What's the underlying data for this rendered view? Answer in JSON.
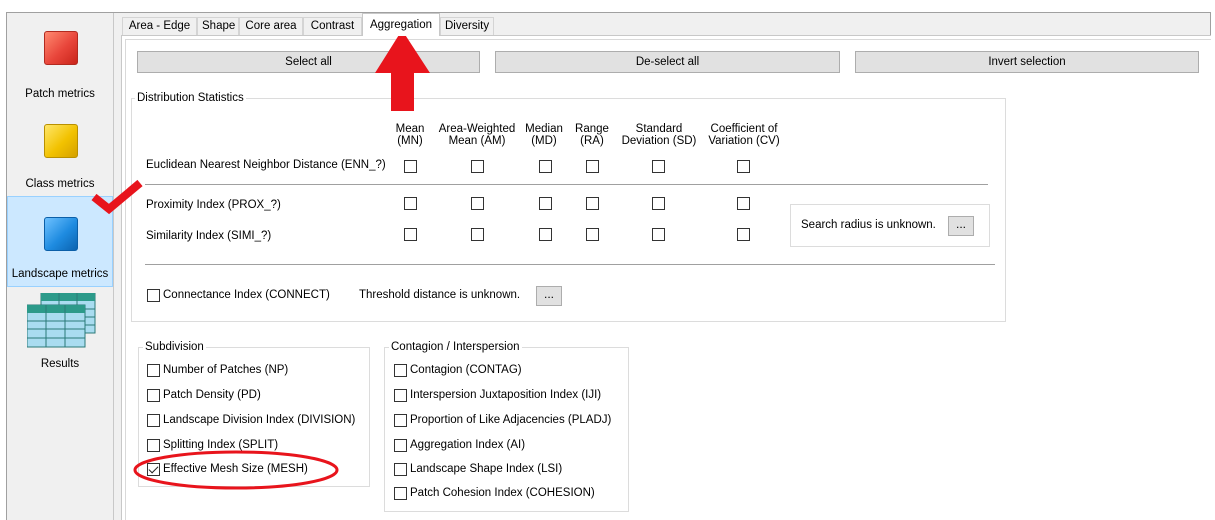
{
  "sidebar": {
    "items": [
      {
        "label": "Patch metrics",
        "color": "#e8453a"
      },
      {
        "label": "Class metrics",
        "color": "#f2c200"
      },
      {
        "label": "Landscape metrics",
        "color": "#1e8be0"
      },
      {
        "label": "Results"
      }
    ]
  },
  "tabs": [
    "Area - Edge",
    "Shape",
    "Core area",
    "Contrast",
    "Aggregation",
    "Diversity"
  ],
  "active_tab": "Aggregation",
  "buttons": {
    "select_all": "Select all",
    "deselect_all": "De-select all",
    "invert": "Invert selection"
  },
  "distribution": {
    "title": "Distribution Statistics",
    "columns": [
      "Mean\n(MN)",
      "Area-Weighted\nMean (AM)",
      "Median\n(MD)",
      "Range\n(RA)",
      "Standard\nDeviation (SD)",
      "Coefficient of\nVariation (CV)"
    ],
    "rows": [
      {
        "label": "Euclidean Nearest Neighbor Distance  (ENN_?)",
        "checked": [
          false,
          false,
          false,
          false,
          false,
          false
        ]
      },
      {
        "label": "Proximity Index  (PROX_?)",
        "checked": [
          false,
          false,
          false,
          false,
          false,
          false
        ]
      },
      {
        "label": "Similarity Index  (SIMI_?)",
        "checked": [
          false,
          false,
          false,
          false,
          false,
          false
        ]
      }
    ],
    "search_radius_text": "Search radius is unknown.",
    "radius_button": "...",
    "connectance_label": "Connectance Index  (CONNECT)",
    "connectance_checked": false,
    "threshold_text": "Threshold distance is unknown.",
    "threshold_button": "..."
  },
  "subdivision": {
    "title": "Subdivision",
    "items": [
      {
        "label": "Number of Patches  (NP)",
        "checked": false
      },
      {
        "label": "Patch Density  (PD)",
        "checked": false
      },
      {
        "label": "Landscape Division Index  (DIVISION)",
        "checked": false
      },
      {
        "label": "Splitting Index  (SPLIT)",
        "checked": false
      },
      {
        "label": "Effective Mesh Size  (MESH)",
        "checked": true
      }
    ]
  },
  "contagion": {
    "title": "Contagion / Interspersion",
    "items": [
      {
        "label": "Contagion  (CONTAG)",
        "checked": false
      },
      {
        "label": "Interspersion  Juxtaposition Index  (IJI)",
        "checked": false
      },
      {
        "label": "Proportion of Like Adjacencies  (PLADJ)",
        "checked": false
      },
      {
        "label": "Aggregation Index  (AI)",
        "checked": false
      },
      {
        "label": "Landscape Shape Index  (LSI)",
        "checked": false
      },
      {
        "label": "Patch Cohesion Index  (COHESION)",
        "checked": false
      }
    ]
  },
  "annotation_colors": {
    "arrow": "#e8141c",
    "ellipse": "#e8141c",
    "checkmark": "#e8141c"
  }
}
